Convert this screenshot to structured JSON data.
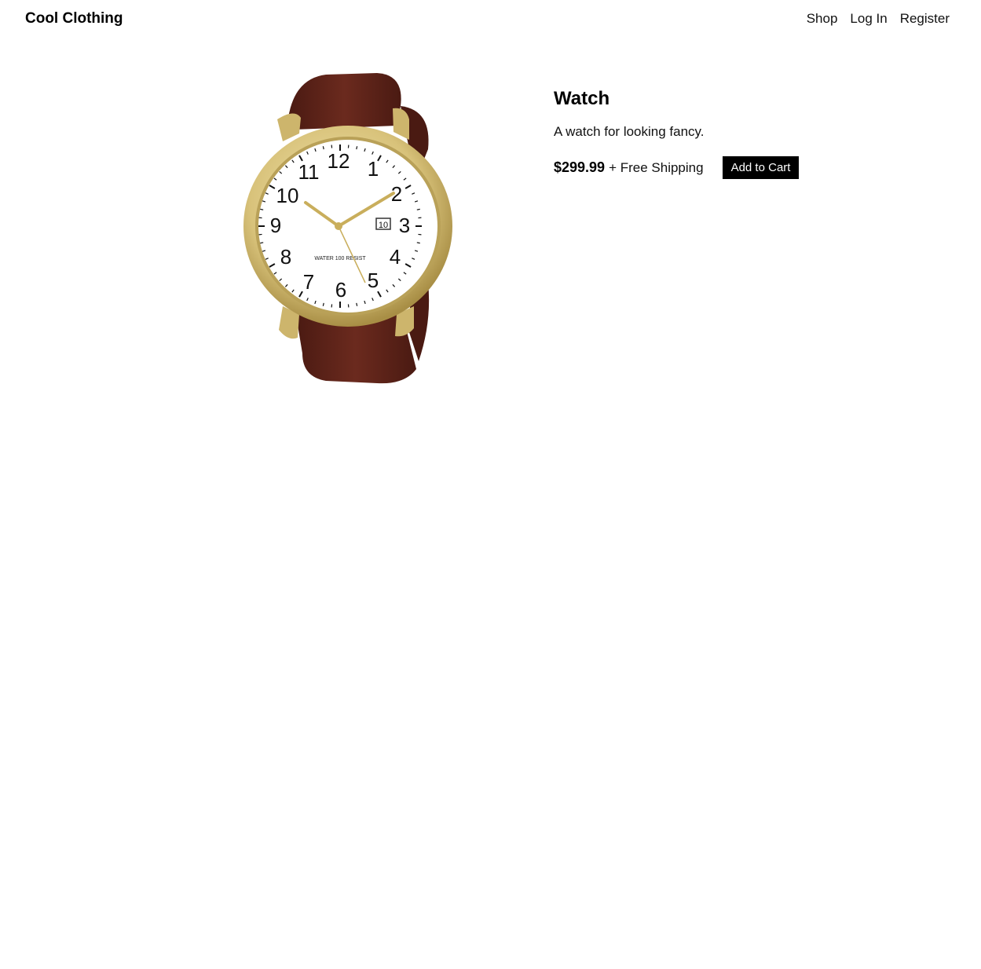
{
  "header": {
    "brand": "Cool Clothing",
    "nav": [
      {
        "label": "Shop"
      },
      {
        "label": "Log In"
      },
      {
        "label": "Register"
      }
    ]
  },
  "product": {
    "title": "Watch",
    "description": "A watch for looking fancy.",
    "price": "$299.99",
    "shipping": "+ Free Shipping",
    "add_to_cart_label": "Add to Cart",
    "image": {
      "subject": "gold watch with brown leather strap",
      "dial_numerals": [
        "12",
        "1",
        "2",
        "3",
        "4",
        "5",
        "6",
        "7",
        "8",
        "9",
        "10",
        "11"
      ],
      "date_window": "10",
      "dial_text": "WATER 100 RESIST",
      "colors": {
        "strap": "#5c2218",
        "case": "#d8c27a",
        "dial": "#ffffff"
      }
    }
  }
}
